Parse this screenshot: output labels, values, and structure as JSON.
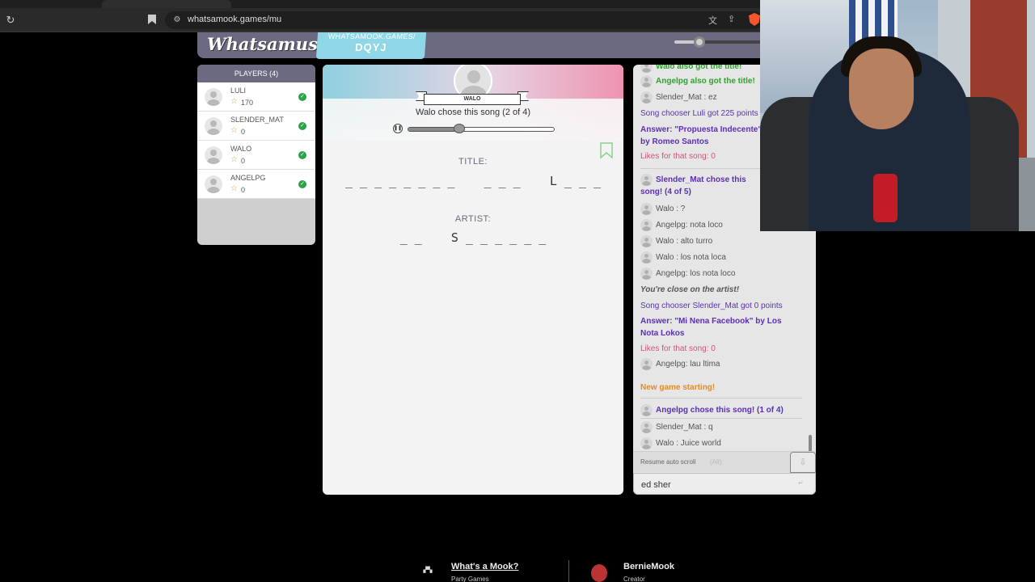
{
  "browser": {
    "url": "whatsamook.games/mu"
  },
  "header": {
    "logo": "Whatsamusic",
    "room_label": "WHATSAMOOK.GAMES/",
    "room_code": "DQYJ",
    "volume": 0.28
  },
  "players": {
    "title": "PLAYERS (4)",
    "list": [
      {
        "name": "LULI",
        "points": "170"
      },
      {
        "name": "SLENDER_MAT",
        "points": "0"
      },
      {
        "name": "WALO",
        "points": "0"
      },
      {
        "name": "ANGELPG",
        "points": "0"
      }
    ]
  },
  "main": {
    "chooser": "WALO",
    "chose_text": "Walo chose this song (2 of 4)",
    "progress": 0.35,
    "title_label": "TITLE:",
    "title_blanks": "_ _ _ _ _ _ _ _    _ _ _    L _ _ _",
    "artist_label": "ARTIST:",
    "artist_blanks": "_ _    S _ _ _ _ _ _"
  },
  "chat": {
    "messages": [
      {
        "text": "Walo also got the title!",
        "style": "green"
      },
      {
        "text": "Angelpg also got the title!",
        "style": "green"
      },
      {
        "text": "Slender_Mat : ez",
        "style": "normal"
      },
      {
        "text": "Song chooser Luli got 225 points",
        "style": "purple"
      },
      {
        "text": "Answer: \"Propuesta Indecente\" by Romeo Santos",
        "style": "purpleb"
      },
      {
        "text": "Likes for that song: 0",
        "style": "pink"
      },
      {
        "text": "Slender_Mat chose this song! (4 of 5)",
        "style": "purpleb"
      },
      {
        "text": "Walo : ?",
        "style": "normal"
      },
      {
        "text": "Angelpg: nota loco",
        "style": "normal"
      },
      {
        "text": "Walo : alto turro",
        "style": "normal"
      },
      {
        "text": "Walo : los nota loca",
        "style": "normal"
      },
      {
        "text": "Angelpg: los nota loco",
        "style": "normal"
      },
      {
        "text": "You're close on the artist!",
        "style": "ital"
      },
      {
        "text": "Song chooser Slender_Mat got 0 points",
        "style": "purple"
      },
      {
        "text": "Answer: \"Mi Nena Facebook\" by Los Nota Lokos",
        "style": "purpleb"
      },
      {
        "text": "Likes for that song: 0",
        "style": "pink"
      },
      {
        "text": "Angelpg: lau ltima",
        "style": "normal"
      },
      {
        "text": "New game starting!",
        "style": "orange"
      },
      {
        "text": "Angelpg chose this song! (1 of 4)",
        "style": "purpleb"
      },
      {
        "text": "Slender_Mat : q",
        "style": "normal"
      },
      {
        "text": "Walo : Juice world",
        "style": "normal"
      }
    ],
    "resume_label": "Resume auto scroll",
    "resume_key": "(Alt)",
    "input_value": "ed sher"
  },
  "footer": {
    "mook_link": "What's a Mook?",
    "mook_sub": "Party Games",
    "creator_name": "BernieMook",
    "creator_sub": "Creator"
  }
}
